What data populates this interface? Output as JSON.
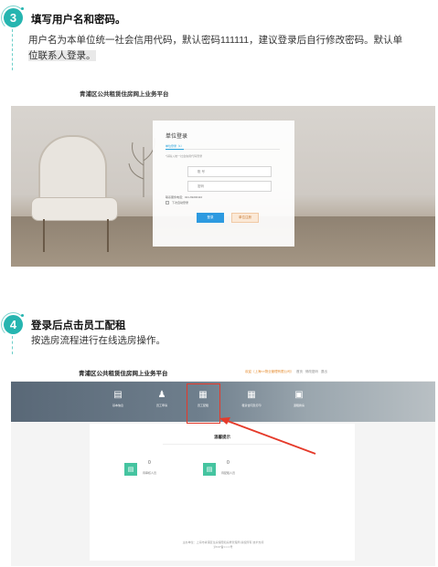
{
  "step3": {
    "number": "3",
    "title": "填写用户名和密码。",
    "desc_line1": "用户名为本单位统一社会信用代码，默认密码111111，建议登录后自行修改密码。默认单",
    "desc_line2": "位联系人登录。"
  },
  "shot1": {
    "caption": "青浦区公共租赁住房网上业务平台",
    "card": {
      "title": "单位登录",
      "tab": "单位登录（1）",
      "hint": "*请输入统一社会信用代码登录",
      "user_placeholder": "账 号",
      "pass_placeholder": "密码",
      "phone_line": "联系服务电话：021-69200110",
      "remember": "下次自动登录",
      "login_btn": "登录",
      "contact_btn": "单位注册"
    }
  },
  "step4": {
    "number": "4",
    "title": "登录后点击员工配租",
    "desc": "按选房流程进行在线选房操作。"
  },
  "shot2": {
    "title": "青浦区公共租赁住房网上业务平台",
    "topbar_right": {
      "welcome": "欢迎（上海××物业管理有限公司）",
      "home": "首页",
      "password": "修改密码",
      "logout": "退出"
    },
    "nav": [
      {
        "label": "基本信息",
        "icon": "document-icon"
      },
      {
        "label": "员工申请",
        "icon": "user-add-icon"
      },
      {
        "label": "员工配租",
        "icon": "calendar-icon"
      },
      {
        "label": "租赁合同及打印",
        "icon": "calendar-icon"
      },
      {
        "label": "退租换房",
        "icon": "id-card-icon"
      }
    ],
    "panel_title": "温馨提示",
    "cards": [
      {
        "label": "待审核人员",
        "num": "0"
      },
      {
        "label": "待配租人员",
        "num": "0"
      }
    ],
    "footer_line1": "主办单位：上海市青浦区住房保障和房屋管理局  版权所有  技术支持",
    "footer_line2": "沪ICP备××××号"
  },
  "colors": {
    "accent": "#26b5b0",
    "highlight_box": "#e53a2a"
  }
}
